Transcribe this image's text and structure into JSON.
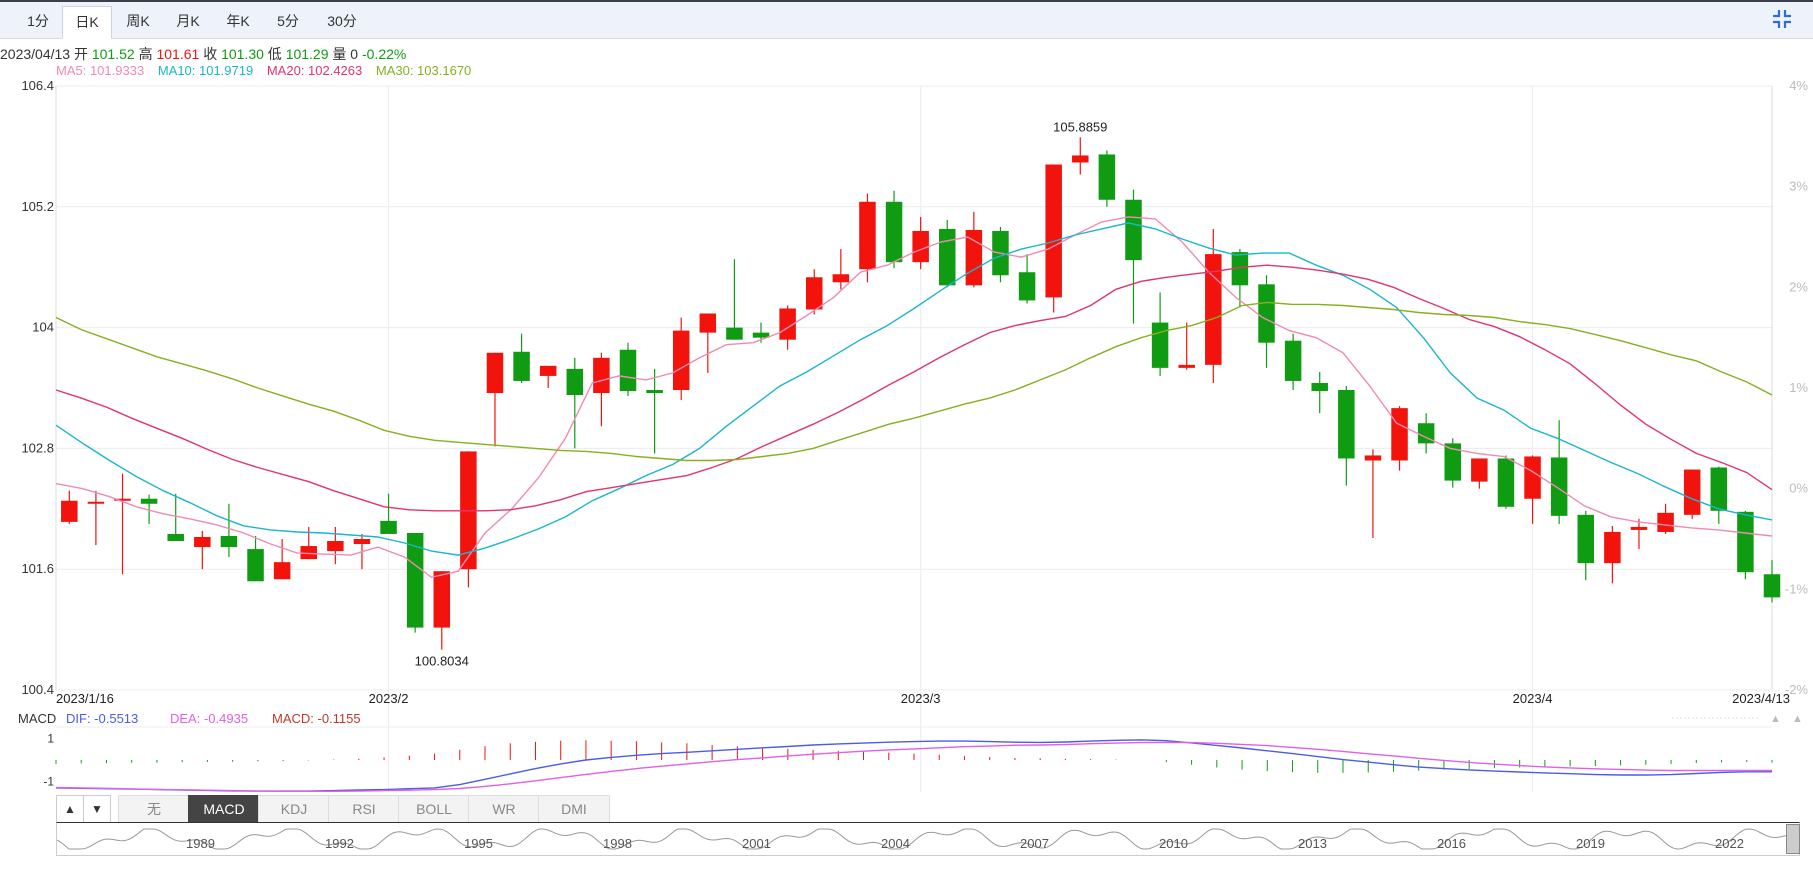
{
  "tabs": [
    "1分",
    "日K",
    "周K",
    "月K",
    "年K",
    "5分",
    "30分"
  ],
  "active_tab": "日K",
  "info": {
    "date": "2023/04/13",
    "open_label": "开",
    "open": "101.52",
    "high_label": "高",
    "high": "101.61",
    "close_label": "收",
    "close": "101.30",
    "low_label": "低",
    "low": "101.29",
    "vol_label": "量",
    "vol": "0",
    "change": "-0.22%"
  },
  "ma": [
    {
      "label": "MA5: 101.9333",
      "color": "#f08ab4"
    },
    {
      "label": "MA10: 101.9719",
      "color": "#1ab6cf"
    },
    {
      "label": "MA20: 102.4263",
      "color": "#e2346c"
    },
    {
      "label": "MA30: 103.1670",
      "color": "#86b01e"
    }
  ],
  "macd_info": {
    "name": "MACD",
    "dif": "DIF: -0.5513",
    "dea": "DEA: -0.4935",
    "macd": "MACD: -0.1155"
  },
  "indicator_tabs": [
    "无",
    "MACD",
    "KDJ",
    "RSI",
    "BOLL",
    "WR",
    "DMI"
  ],
  "active_indicator": "MACD",
  "nav_years": [
    "1989",
    "1992",
    "1995",
    "1998",
    "2001",
    "2004",
    "2007",
    "2010",
    "2013",
    "2016",
    "2019",
    "2022"
  ],
  "colors": {
    "up": "#f2140c",
    "down": "#0f9c12",
    "dif": "#4a5ce8",
    "dea": "#e060e8",
    "grid": "#ececec"
  },
  "chart_data": {
    "type": "candlestick",
    "y_axis_labels": [
      "106.4",
      "105.2",
      "104",
      "102.8",
      "101.6",
      "100.4"
    ],
    "ylim": [
      100.4,
      106.4
    ],
    "right_axis_labels": [
      "4%",
      "3%",
      "2%",
      "1%",
      "0%",
      "-1%",
      "-2%"
    ],
    "x_labels": [
      "2023/1/16",
      "2023/2",
      "2023/3",
      "2023/4",
      "2023/4/13"
    ],
    "annotations": {
      "max": "105.8859",
      "min": "100.8034"
    },
    "candles": [
      {
        "o": 102.07,
        "h": 102.38,
        "l": 102.05,
        "c": 102.28
      },
      {
        "o": 102.26,
        "h": 102.38,
        "l": 101.84,
        "c": 102.27
      },
      {
        "o": 102.28,
        "h": 102.55,
        "l": 101.55,
        "c": 102.3
      },
      {
        "o": 102.3,
        "h": 102.34,
        "l": 102.05,
        "c": 102.25
      },
      {
        "o": 101.95,
        "h": 102.35,
        "l": 101.88,
        "c": 101.88
      },
      {
        "o": 101.82,
        "h": 101.98,
        "l": 101.6,
        "c": 101.92
      },
      {
        "o": 101.93,
        "h": 102.25,
        "l": 101.72,
        "c": 101.82
      },
      {
        "o": 101.8,
        "h": 101.93,
        "l": 101.62,
        "c": 101.48
      },
      {
        "o": 101.5,
        "h": 101.9,
        "l": 101.55,
        "c": 101.67
      },
      {
        "o": 101.7,
        "h": 102.02,
        "l": 101.7,
        "c": 101.83
      },
      {
        "o": 101.78,
        "h": 102.02,
        "l": 101.65,
        "c": 101.88
      },
      {
        "o": 101.85,
        "h": 101.95,
        "l": 101.6,
        "c": 101.9
      },
      {
        "o": 102.08,
        "h": 102.35,
        "l": 101.98,
        "c": 101.95
      },
      {
        "o": 101.96,
        "h": 101.96,
        "l": 100.97,
        "c": 101.02
      },
      {
        "o": 101.02,
        "h": 101.58,
        "l": 100.8,
        "c": 101.58
      },
      {
        "o": 101.6,
        "h": 102.77,
        "l": 101.42,
        "c": 102.77
      },
      {
        "o": 103.35,
        "h": 103.57,
        "l": 102.82,
        "c": 103.75
      },
      {
        "o": 103.76,
        "h": 103.94,
        "l": 103.45,
        "c": 103.47
      },
      {
        "o": 103.52,
        "h": 103.62,
        "l": 103.4,
        "c": 103.62
      },
      {
        "o": 103.59,
        "h": 103.7,
        "l": 102.8,
        "c": 103.33
      },
      {
        "o": 103.35,
        "h": 103.75,
        "l": 103.02,
        "c": 103.7
      },
      {
        "o": 103.78,
        "h": 103.85,
        "l": 103.32,
        "c": 103.37
      },
      {
        "o": 103.38,
        "h": 103.59,
        "l": 102.75,
        "c": 103.35
      },
      {
        "o": 103.38,
        "h": 104.1,
        "l": 103.28,
        "c": 103.97
      },
      {
        "o": 103.95,
        "h": 104.05,
        "l": 103.55,
        "c": 104.14
      },
      {
        "o": 104.0,
        "h": 104.68,
        "l": 103.92,
        "c": 103.88
      },
      {
        "o": 103.95,
        "h": 104.05,
        "l": 103.85,
        "c": 103.9
      },
      {
        "o": 103.88,
        "h": 104.22,
        "l": 103.78,
        "c": 104.19
      },
      {
        "o": 104.18,
        "h": 104.58,
        "l": 104.13,
        "c": 104.5
      },
      {
        "o": 104.45,
        "h": 104.78,
        "l": 104.38,
        "c": 104.53
      },
      {
        "o": 104.58,
        "h": 105.33,
        "l": 104.45,
        "c": 105.25
      },
      {
        "o": 105.25,
        "h": 105.36,
        "l": 104.59,
        "c": 104.65
      },
      {
        "o": 104.65,
        "h": 105.1,
        "l": 104.58,
        "c": 104.96
      },
      {
        "o": 104.98,
        "h": 105.07,
        "l": 104.4,
        "c": 104.42
      },
      {
        "o": 104.42,
        "h": 105.15,
        "l": 104.4,
        "c": 104.97
      },
      {
        "o": 104.96,
        "h": 105.0,
        "l": 104.45,
        "c": 104.52
      },
      {
        "o": 104.55,
        "h": 104.73,
        "l": 104.24,
        "c": 104.27
      },
      {
        "o": 104.3,
        "h": 105.6,
        "l": 104.15,
        "c": 105.62
      },
      {
        "o": 105.64,
        "h": 105.89,
        "l": 105.52,
        "c": 105.71
      },
      {
        "o": 105.72,
        "h": 105.76,
        "l": 105.2,
        "c": 105.27
      },
      {
        "o": 105.27,
        "h": 105.37,
        "l": 104.04,
        "c": 104.67
      },
      {
        "o": 104.05,
        "h": 104.35,
        "l": 103.52,
        "c": 103.6
      },
      {
        "o": 103.6,
        "h": 104.05,
        "l": 103.58,
        "c": 103.63
      },
      {
        "o": 103.63,
        "h": 104.98,
        "l": 103.45,
        "c": 104.73
      },
      {
        "o": 104.75,
        "h": 104.78,
        "l": 104.2,
        "c": 104.42
      },
      {
        "o": 104.43,
        "h": 104.52,
        "l": 103.6,
        "c": 103.85
      },
      {
        "o": 103.87,
        "h": 103.94,
        "l": 103.38,
        "c": 103.47
      },
      {
        "o": 103.45,
        "h": 103.56,
        "l": 103.15,
        "c": 103.37
      },
      {
        "o": 103.38,
        "h": 103.42,
        "l": 102.43,
        "c": 102.7
      },
      {
        "o": 102.68,
        "h": 102.79,
        "l": 101.91,
        "c": 102.73
      },
      {
        "o": 102.68,
        "h": 103.22,
        "l": 102.58,
        "c": 103.2
      },
      {
        "o": 103.05,
        "h": 103.15,
        "l": 102.75,
        "c": 102.85
      },
      {
        "o": 102.85,
        "h": 102.9,
        "l": 102.41,
        "c": 102.48
      },
      {
        "o": 102.47,
        "h": 102.7,
        "l": 102.4,
        "c": 102.7
      },
      {
        "o": 102.7,
        "h": 102.73,
        "l": 102.2,
        "c": 102.22
      },
      {
        "o": 102.3,
        "h": 102.73,
        "l": 102.05,
        "c": 102.72
      },
      {
        "o": 102.71,
        "h": 103.08,
        "l": 102.05,
        "c": 102.13
      },
      {
        "o": 102.14,
        "h": 102.18,
        "l": 101.49,
        "c": 101.66
      },
      {
        "o": 101.66,
        "h": 102.03,
        "l": 101.46,
        "c": 101.97
      },
      {
        "o": 101.99,
        "h": 102.1,
        "l": 101.8,
        "c": 102.02
      },
      {
        "o": 101.97,
        "h": 102.25,
        "l": 101.95,
        "c": 102.16
      },
      {
        "o": 102.14,
        "h": 102.52,
        "l": 102.1,
        "c": 102.59
      },
      {
        "o": 102.61,
        "h": 102.62,
        "l": 102.05,
        "c": 102.18
      },
      {
        "o": 102.17,
        "h": 102.18,
        "l": 101.5,
        "c": 101.57
      },
      {
        "o": 101.55,
        "h": 101.69,
        "l": 101.27,
        "c": 101.32
      }
    ],
    "ma_series": [
      {
        "name": "MA5",
        "color": "#f08ab4",
        "values": [
          102.45,
          102.4,
          102.32,
          102.22,
          102.15,
          102.1,
          102.04,
          101.96,
          101.85,
          101.76,
          101.75,
          101.74,
          101.82,
          101.72,
          101.52,
          101.58,
          101.96,
          102.2,
          102.51,
          102.9,
          103.45,
          103.52,
          103.48,
          103.55,
          103.7,
          103.83,
          103.85,
          103.95,
          104.12,
          104.3,
          104.55,
          104.62,
          104.75,
          104.85,
          104.9,
          104.75,
          104.7,
          104.78,
          104.92,
          105.05,
          105.1,
          105.08,
          104.85,
          104.55,
          104.3,
          104.1,
          103.97,
          103.9,
          103.75,
          103.42,
          103.05,
          102.92,
          102.8,
          102.75,
          102.72,
          102.58,
          102.41,
          102.23,
          102.12,
          102.07,
          102.04,
          102.01,
          101.99,
          101.96,
          101.93
        ]
      },
      {
        "name": "MA10",
        "color": "#1ab6cf",
        "values": [
          103.03,
          102.85,
          102.68,
          102.52,
          102.38,
          102.26,
          102.13,
          102.03,
          101.99,
          101.97,
          101.96,
          101.94,
          101.92,
          101.86,
          101.78,
          101.74,
          101.81,
          101.9,
          102.0,
          102.12,
          102.28,
          102.4,
          102.53,
          102.64,
          102.8,
          103.02,
          103.22,
          103.42,
          103.56,
          103.72,
          103.88,
          104.02,
          104.19,
          104.37,
          104.54,
          104.69,
          104.78,
          104.84,
          104.92,
          104.98,
          105.04,
          104.98,
          104.88,
          104.79,
          104.72,
          104.74,
          104.74,
          104.62,
          104.52,
          104.38,
          104.2,
          103.9,
          103.55,
          103.3,
          103.18,
          103.0,
          102.9,
          102.78,
          102.66,
          102.55,
          102.42,
          102.3,
          102.2,
          102.14,
          102.09
        ]
      },
      {
        "name": "MA20",
        "color": "#e2346c",
        "values": [
          103.38,
          103.3,
          103.21,
          103.1,
          103.0,
          102.9,
          102.79,
          102.69,
          102.61,
          102.54,
          102.47,
          102.38,
          102.3,
          102.22,
          102.19,
          102.18,
          102.18,
          102.18,
          102.19,
          102.23,
          102.29,
          102.37,
          102.41,
          102.45,
          102.49,
          102.53,
          102.61,
          102.7,
          102.82,
          102.93,
          103.04,
          103.16,
          103.29,
          103.43,
          103.56,
          103.7,
          103.83,
          103.95,
          104.02,
          104.07,
          104.11,
          104.22,
          104.38,
          104.46,
          104.5,
          104.53,
          104.56,
          104.6,
          104.62,
          104.6,
          104.57,
          104.53,
          104.48,
          104.4,
          104.29,
          104.19,
          104.08,
          104.01,
          103.91,
          103.78,
          103.64,
          103.44,
          103.23,
          103.04,
          102.89,
          102.75,
          102.66,
          102.56,
          102.39
        ]
      },
      {
        "name": "MA30",
        "color": "#86b01e",
        "values": [
          104.1,
          103.98,
          103.89,
          103.8,
          103.71,
          103.64,
          103.57,
          103.49,
          103.4,
          103.32,
          103.24,
          103.17,
          103.08,
          102.98,
          102.92,
          102.88,
          102.86,
          102.84,
          102.82,
          102.8,
          102.78,
          102.77,
          102.75,
          102.72,
          102.7,
          102.68,
          102.68,
          102.69,
          102.72,
          102.75,
          102.8,
          102.88,
          102.96,
          103.04,
          103.1,
          103.17,
          103.24,
          103.3,
          103.38,
          103.48,
          103.58,
          103.7,
          103.81,
          103.9,
          103.97,
          104.02,
          104.1,
          104.22,
          104.25,
          104.23,
          104.23,
          104.22,
          104.2,
          104.18,
          104.15,
          104.13,
          104.12,
          104.1,
          104.06,
          104.03,
          103.99,
          103.93,
          103.87,
          103.8,
          103.73,
          103.67,
          103.56,
          103.46,
          103.33
        ]
      }
    ],
    "macd": {
      "ylim": [
        -1.4,
        1.4
      ],
      "y_labels": [
        "1",
        "-1"
      ],
      "dif": [
        -1.3,
        -1.32,
        -1.34,
        -1.36,
        -1.38,
        -1.4,
        -1.42,
        -1.44,
        -1.45,
        -1.45,
        -1.45,
        -1.43,
        -1.4,
        -1.38,
        -1.34,
        -1.3,
        -1.15,
        -0.9,
        -0.65,
        -0.4,
        -0.18,
        0.0,
        0.12,
        0.22,
        0.3,
        0.36,
        0.43,
        0.5,
        0.57,
        0.63,
        0.7,
        0.75,
        0.79,
        0.83,
        0.86,
        0.88,
        0.88,
        0.86,
        0.83,
        0.82,
        0.84,
        0.88,
        0.92,
        0.94,
        0.9,
        0.8,
        0.68,
        0.56,
        0.43,
        0.3,
        0.16,
        0.02,
        -0.1,
        -0.22,
        -0.33,
        -0.4,
        -0.46,
        -0.52,
        -0.56,
        -0.6,
        -0.64,
        -0.68,
        -0.7,
        -0.7,
        -0.68,
        -0.63,
        -0.58,
        -0.55,
        -0.55
      ],
      "dea": [
        -1.28,
        -1.3,
        -1.32,
        -1.35,
        -1.37,
        -1.39,
        -1.41,
        -1.43,
        -1.45,
        -1.46,
        -1.46,
        -1.46,
        -1.45,
        -1.43,
        -1.41,
        -1.38,
        -1.33,
        -1.23,
        -1.11,
        -0.97,
        -0.82,
        -0.67,
        -0.53,
        -0.4,
        -0.29,
        -0.18,
        -0.08,
        0.02,
        0.1,
        0.19,
        0.27,
        0.34,
        0.41,
        0.47,
        0.52,
        0.57,
        0.62,
        0.65,
        0.69,
        0.7,
        0.72,
        0.76,
        0.79,
        0.81,
        0.82,
        0.81,
        0.78,
        0.73,
        0.67,
        0.59,
        0.5,
        0.4,
        0.29,
        0.19,
        0.08,
        -0.02,
        -0.11,
        -0.19,
        -0.26,
        -0.32,
        -0.37,
        -0.41,
        -0.44,
        -0.47,
        -0.49,
        -0.49,
        -0.49,
        -0.49,
        -0.49
      ],
      "hist": [
        -0.18,
        -0.16,
        -0.15,
        -0.13,
        -0.12,
        -0.1,
        -0.09,
        -0.08,
        -0.06,
        -0.05,
        -0.02,
        0.02,
        0.06,
        0.12,
        0.2,
        0.3,
        0.48,
        0.65,
        0.78,
        0.85,
        0.9,
        0.92,
        0.9,
        0.88,
        0.82,
        0.78,
        0.7,
        0.64,
        0.58,
        0.52,
        0.47,
        0.43,
        0.38,
        0.34,
        0.3,
        0.24,
        0.18,
        0.14,
        0.1,
        0.08,
        0.06,
        0.04,
        0.02,
        0.0,
        -0.1,
        -0.22,
        -0.35,
        -0.45,
        -0.52,
        -0.57,
        -0.6,
        -0.6,
        -0.58,
        -0.55,
        -0.5,
        -0.45,
        -0.42,
        -0.38,
        -0.35,
        -0.32,
        -0.3,
        -0.28,
        -0.25,
        -0.22,
        -0.19,
        -0.14,
        -0.11,
        -0.09,
        -0.12
      ]
    }
  }
}
